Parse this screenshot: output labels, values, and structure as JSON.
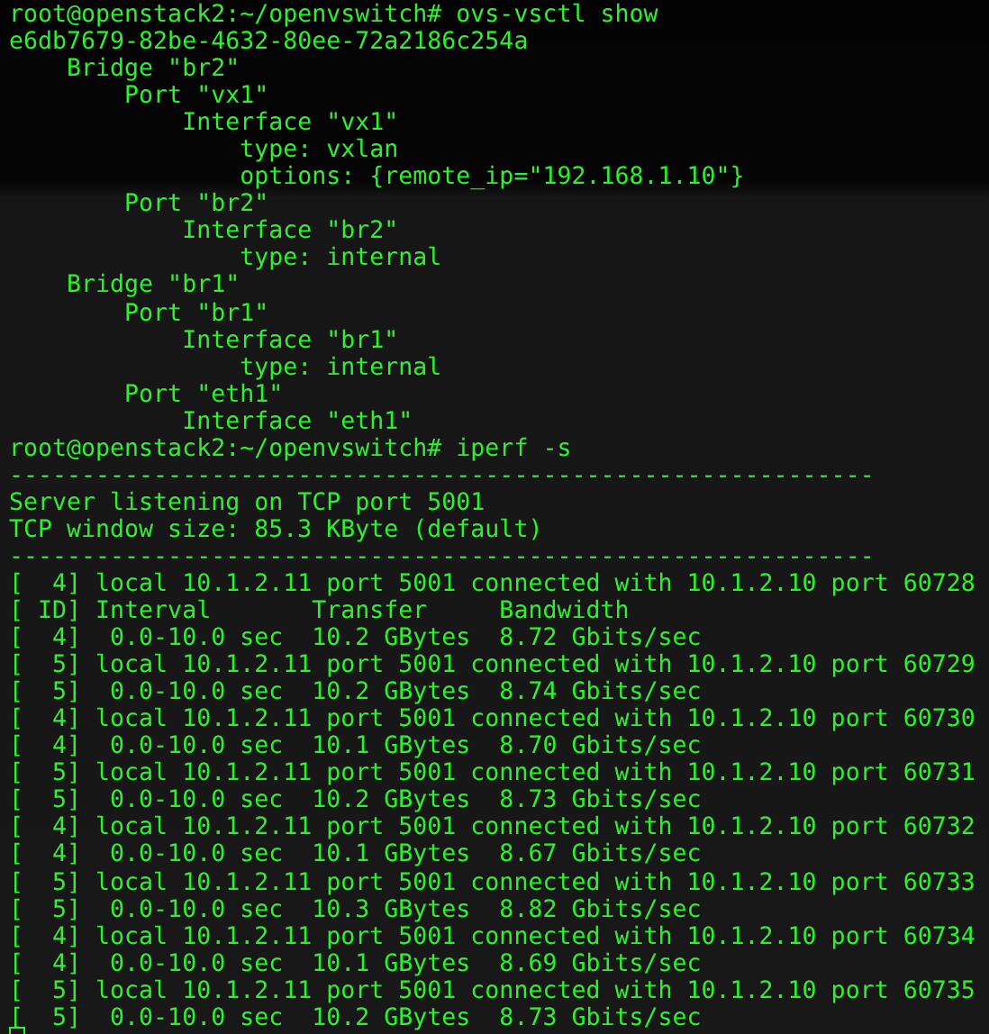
{
  "terminal": {
    "lines": [
      "root@openstack2:~/openvswitch# ovs-vsctl show",
      "e6db7679-82be-4632-80ee-72a2186c254a",
      "    Bridge \"br2\"",
      "        Port \"vx1\"",
      "            Interface \"vx1\"",
      "                type: vxlan",
      "                options: {remote_ip=\"192.168.1.10\"}",
      "        Port \"br2\"",
      "            Interface \"br2\"",
      "                type: internal",
      "    Bridge \"br1\"",
      "        Port \"br1\"",
      "            Interface \"br1\"",
      "                type: internal",
      "        Port \"eth1\"",
      "            Interface \"eth1\"",
      "root@openstack2:~/openvswitch# iperf -s",
      "------------------------------------------------------------",
      "Server listening on TCP port 5001",
      "TCP window size: 85.3 KByte (default)",
      "------------------------------------------------------------",
      "[  4] local 10.1.2.11 port 5001 connected with 10.1.2.10 port 60728",
      "[ ID] Interval       Transfer     Bandwidth",
      "[  4]  0.0-10.0 sec  10.2 GBytes  8.72 Gbits/sec",
      "[  5] local 10.1.2.11 port 5001 connected with 10.1.2.10 port 60729",
      "[  5]  0.0-10.0 sec  10.2 GBytes  8.74 Gbits/sec",
      "[  4] local 10.1.2.11 port 5001 connected with 10.1.2.10 port 60730",
      "[  4]  0.0-10.0 sec  10.1 GBytes  8.70 Gbits/sec",
      "[  5] local 10.1.2.11 port 5001 connected with 10.1.2.10 port 60731",
      "[  5]  0.0-10.0 sec  10.2 GBytes  8.73 Gbits/sec",
      "[  4] local 10.1.2.11 port 5001 connected with 10.1.2.10 port 60732",
      "[  4]  0.0-10.0 sec  10.1 GBytes  8.67 Gbits/sec",
      "[  5] local 10.1.2.11 port 5001 connected with 10.1.2.10 port 60733",
      "[  5]  0.0-10.0 sec  10.3 GBytes  8.82 Gbits/sec",
      "[  4] local 10.1.2.11 port 5001 connected with 10.1.2.10 port 60734",
      "[  4]  0.0-10.0 sec  10.1 GBytes  8.69 Gbits/sec",
      "[  5] local 10.1.2.11 port 5001 connected with 10.1.2.10 port 60735",
      "[  5]  0.0-10.0 sec  10.2 GBytes  8.73 Gbits/sec"
    ],
    "cursor_visible": true
  }
}
